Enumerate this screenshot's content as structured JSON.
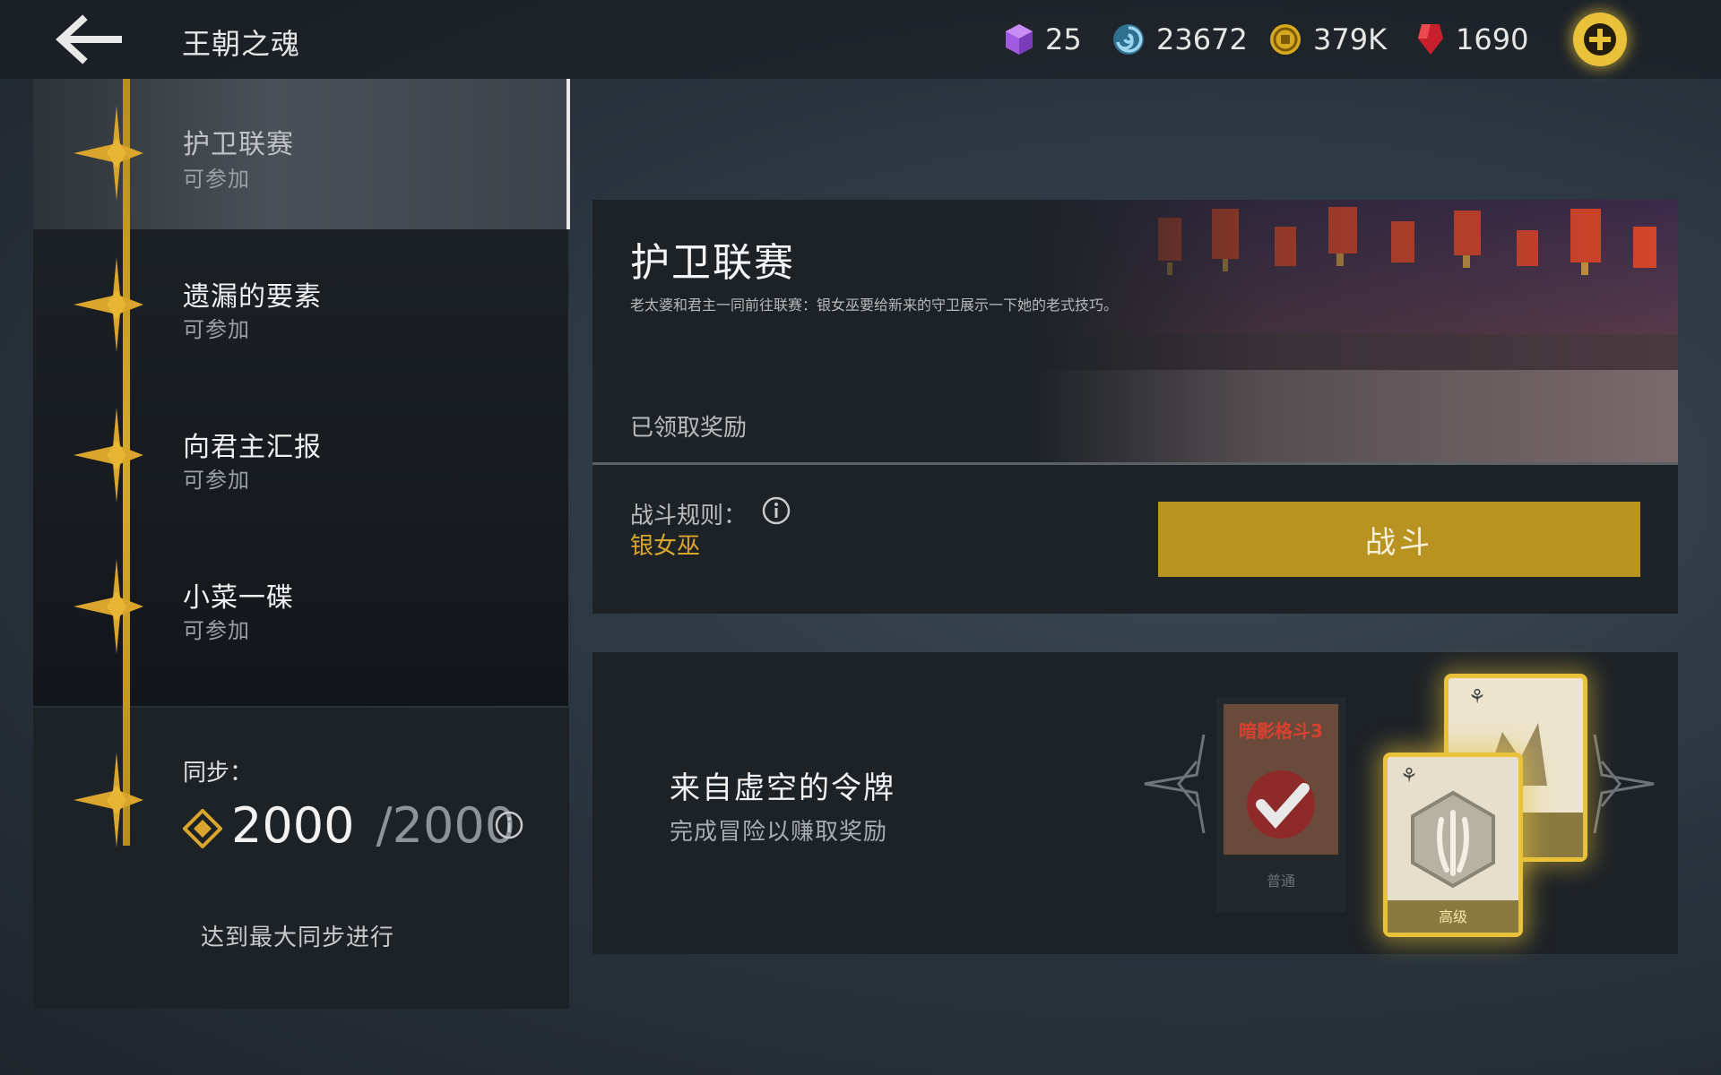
{
  "header": {
    "title": "王朝之魂",
    "currencies": [
      {
        "icon": "purple-gem-icon",
        "value": "25"
      },
      {
        "icon": "swirl-energy-icon",
        "value": "23672"
      },
      {
        "icon": "gold-coin-icon",
        "value": "379K"
      },
      {
        "icon": "red-ruby-icon",
        "value": "1690"
      }
    ]
  },
  "sidebar": {
    "items": [
      {
        "title": "护卫联赛",
        "status": "可参加",
        "active": true
      },
      {
        "title": "遗漏的要素",
        "status": "可参加",
        "active": false
      },
      {
        "title": "向君主汇报",
        "status": "可参加",
        "active": false
      },
      {
        "title": "小菜一碟",
        "status": "可参加",
        "active": false
      }
    ],
    "sync": {
      "label": "同步：",
      "value": "2000",
      "max": "/2000",
      "note": "达到最大同步进行"
    }
  },
  "event": {
    "title": "护卫联赛",
    "description": "老太婆和君主一同前往联赛：银女巫要给新来的守卫展示一下她的老式技巧。",
    "status": "已领取奖励",
    "rules_label": "战斗规则：",
    "rules_value": "银女巫",
    "fight_label": "战斗"
  },
  "reward": {
    "title": "来自虚空的令牌",
    "subtitle": "完成冒险以赚取奖励",
    "card_common_label": "普通",
    "card_advanced_label": "高级",
    "card_logo_text": "暗影格斗3"
  },
  "colors": {
    "accent_gold": "#b99322",
    "highlight_gold": "#d9a52c"
  }
}
